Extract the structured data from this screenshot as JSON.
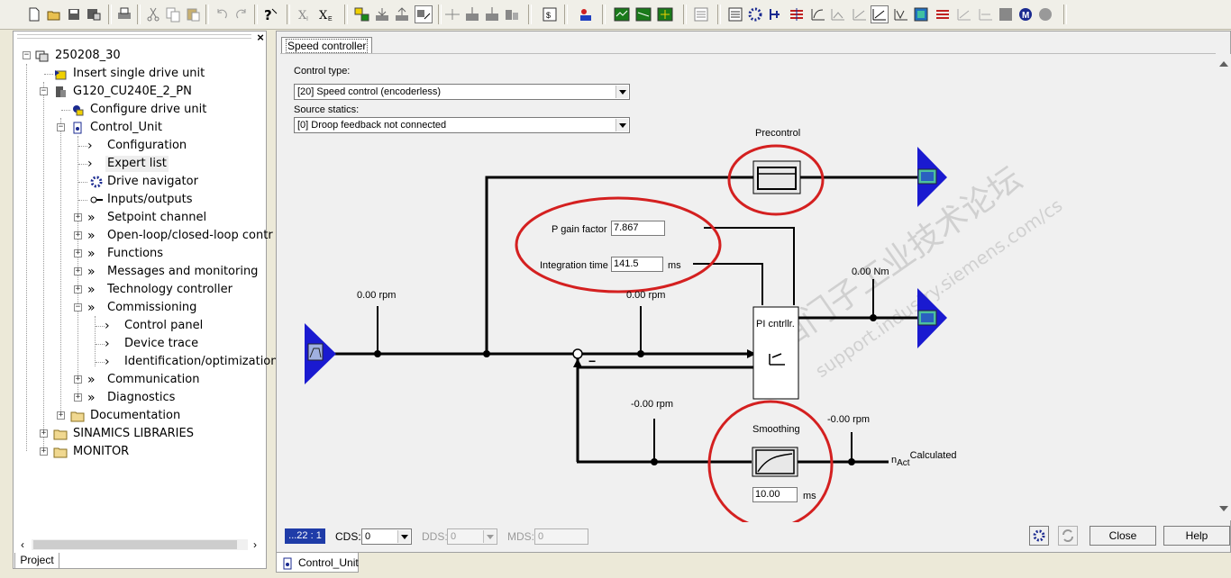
{
  "toolbar": {
    "buttons": [
      "new-icon",
      "open-icon",
      "save-icon",
      "save-compile-icon",
      "print-icon",
      "cut-icon",
      "copy-icon",
      "paste-icon",
      "undo-icon",
      "redo-icon",
      "help-icon",
      "accessible-nodes-icon",
      "x-e-icon",
      "go-online-icon",
      "download-icon",
      "upload-icon",
      "connect-target-icon",
      "device-icon",
      "load-to-pg-icon",
      "copy-ram-rom-icon",
      "restore-icon",
      "target-device-icon",
      "graphics-1-icon",
      "graphics-2-icon",
      "graphics-3-icon",
      "drive-navigator-icon",
      "expert-list-icon",
      "setpoint-icon",
      "cds-icon",
      "oscilloscope-icon",
      "trace-icon",
      "curve-1-icon",
      "curve-2-icon",
      "curve-active-icon",
      "curve-3-icon",
      "parameter-icon",
      "control-icon",
      "curve-4-icon",
      "curve-5-icon",
      "stop-icon",
      "motor-icon",
      "circle-icon"
    ]
  },
  "tree": {
    "close": "×",
    "items": [
      {
        "label": "250208_30"
      },
      {
        "label": "Insert single drive unit"
      },
      {
        "label": "G120_CU240E_2_PN"
      },
      {
        "label": "Configure drive unit"
      },
      {
        "label": "Control_Unit"
      },
      {
        "label": "Configuration"
      },
      {
        "label": "Expert list"
      },
      {
        "label": "Drive navigator"
      },
      {
        "label": "Inputs/outputs"
      },
      {
        "label": "Setpoint channel"
      },
      {
        "label": "Open-loop/closed-loop contr"
      },
      {
        "label": "Functions"
      },
      {
        "label": "Messages and monitoring"
      },
      {
        "label": "Technology controller"
      },
      {
        "label": "Commissioning"
      },
      {
        "label": "Control panel"
      },
      {
        "label": "Device trace"
      },
      {
        "label": "Identification/optimization"
      },
      {
        "label": "Communication"
      },
      {
        "label": "Diagnostics"
      },
      {
        "label": "Documentation"
      },
      {
        "label": "SINAMICS LIBRARIES"
      },
      {
        "label": "MONITOR"
      }
    ],
    "project_tab": "Project"
  },
  "main": {
    "tab": "Speed controller",
    "control_type_label": "Control type:",
    "control_type_value": "[20] Speed control (encoderless)",
    "source_statics_label": "Source statics:",
    "source_statics_value": "[0] Droop feedback not connected"
  },
  "diagram": {
    "precontrol_label": "Precontrol",
    "p_gain_label": "P gain factor",
    "p_gain_value": "7.867",
    "integration_label": "Integration time",
    "integration_value": "141.5",
    "integration_unit": "ms",
    "input_speed": "0.00 rpm",
    "error_speed": "0.00 rpm",
    "torque": "0.00 Nm",
    "pi_label": "PI cntrllr.",
    "feedback_speed": "-0.00 rpm",
    "actual_speed": "-0.00 rpm",
    "smoothing_label": "Smoothing",
    "smoothing_value": "10.00",
    "smoothing_unit": "ms",
    "n_act_main": "n",
    "n_act_sub": "Act",
    "n_act_suffix": "Calculated",
    "minus_sign": "−",
    "watermark_1": "西门子工业技术论坛",
    "watermark_2": "support.industry.siemens.com/cs",
    "annotation_color": "#d42020"
  },
  "status": {
    "id": "...22 : 1",
    "cds_label": "CDS:",
    "cds_value": "0",
    "dds_label": "DDS:",
    "dds_value": "0",
    "mds_label": "MDS:",
    "mds_value": "0",
    "close_button": "Close",
    "help_button": "Help"
  },
  "bottom_tab": {
    "label": "Control_Unit"
  }
}
